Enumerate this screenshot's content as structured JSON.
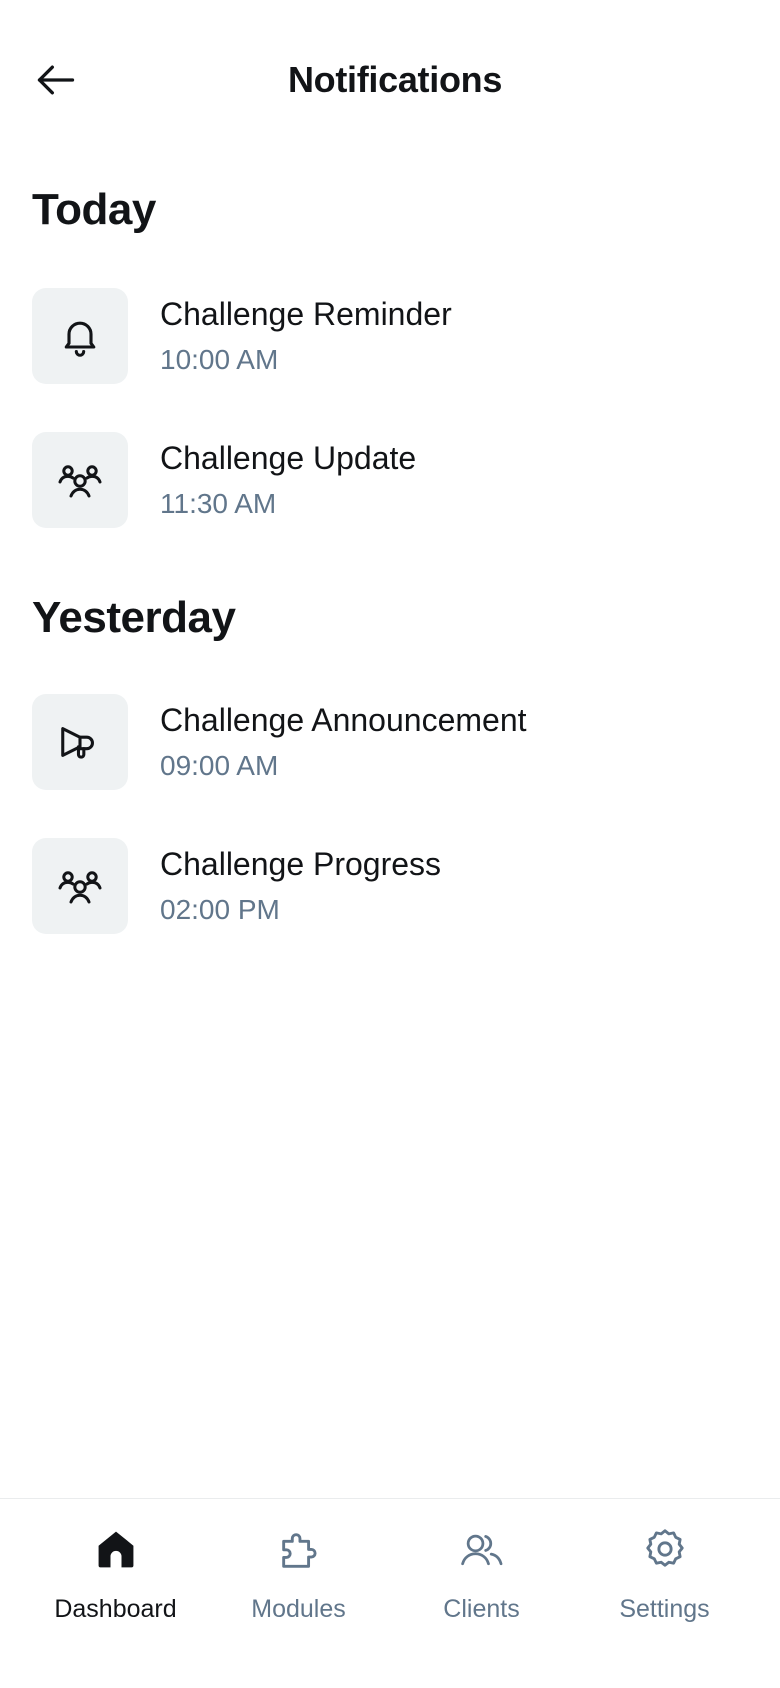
{
  "header": {
    "title": "Notifications",
    "back_icon": "arrow-left-icon"
  },
  "sections": [
    {
      "title": "Today",
      "items": [
        {
          "title": "Challenge Reminder",
          "time": "10:00 AM",
          "icon": "bell-icon"
        },
        {
          "title": "Challenge Update",
          "time": "11:30 AM",
          "icon": "users-group-icon"
        }
      ]
    },
    {
      "title": "Yesterday",
      "items": [
        {
          "title": "Challenge Announcement",
          "time": "09:00 AM",
          "icon": "megaphone-icon"
        },
        {
          "title": "Challenge Progress",
          "time": "02:00 PM",
          "icon": "users-group-icon"
        }
      ]
    }
  ],
  "bottom_nav": {
    "active": "Dashboard",
    "items": [
      {
        "label": "Dashboard",
        "icon": "home-icon"
      },
      {
        "label": "Modules",
        "icon": "puzzle-icon"
      },
      {
        "label": "Clients",
        "icon": "users-icon"
      },
      {
        "label": "Settings",
        "icon": "gear-icon"
      }
    ]
  },
  "colors": {
    "text_primary": "#121417",
    "text_secondary": "#61768b",
    "icon_tile_bg": "#eff2f3",
    "background": "#ffffff"
  }
}
